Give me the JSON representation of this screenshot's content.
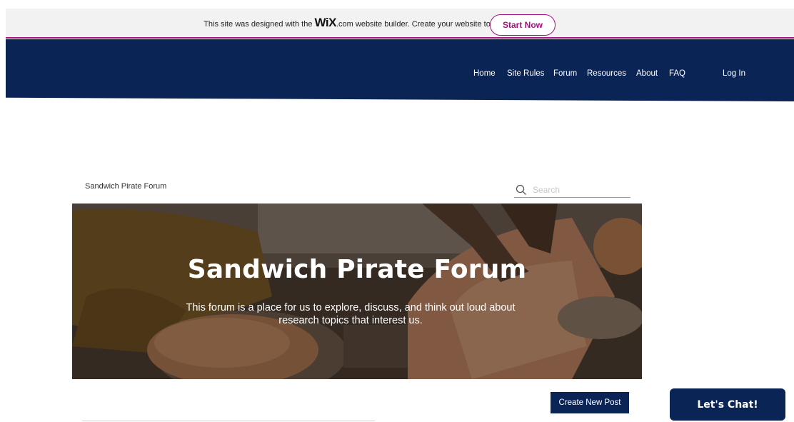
{
  "wix_banner": {
    "text_before": "This site was designed with the",
    "logo": "WiX",
    "text_after": ".com website builder. Create your website today.",
    "cta": "Start Now"
  },
  "nav": {
    "items": [
      "Home",
      "Site Rules",
      "Forum",
      "Resources",
      "About",
      "FAQ"
    ],
    "login": "Log In"
  },
  "forum": {
    "breadcrumb": "Sandwich Pirate Forum",
    "search_placeholder": "Search",
    "hero_title": "Sandwich Pirate Forum",
    "hero_subtitle_line1": "This forum is a place for us to explore, discuss, and think out loud about",
    "hero_subtitle_line2": "research topics that interest us.",
    "create_post": "Create New Post"
  },
  "chat": {
    "label": "Let's Chat!"
  },
  "colors": {
    "header_navy": "#0b2456",
    "wix_accent": "#a3127e",
    "banner_bg": "#f2f2f2"
  }
}
